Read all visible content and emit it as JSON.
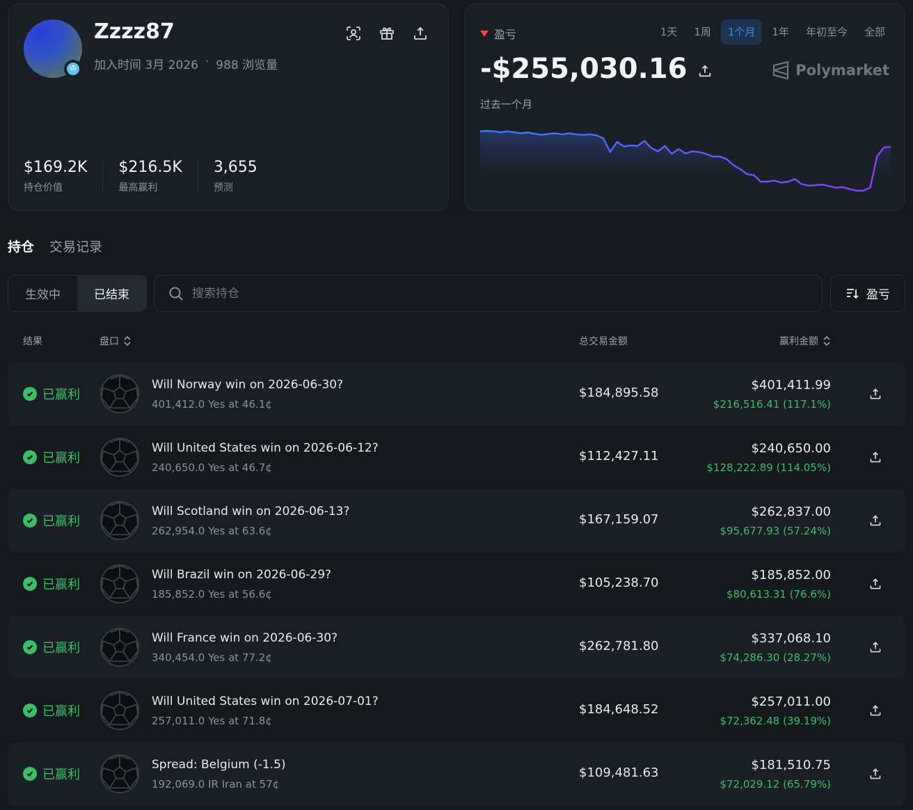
{
  "profile": {
    "username": "Zzzz87",
    "joined": "加入时间 3月 2026",
    "separator": "·",
    "views": "988 浏览量",
    "stats": [
      {
        "value": "$169.2K",
        "label": "持仓价值"
      },
      {
        "value": "$216.5K",
        "label": "最高赢利"
      },
      {
        "value": "3,655",
        "label": "预测"
      }
    ],
    "icons": [
      "scan-face-icon",
      "gift-icon",
      "share-icon"
    ]
  },
  "pnl": {
    "label": "盈亏",
    "value": "-$255,030.16",
    "period": "过去一个月",
    "brand": "Polymarket",
    "ranges": [
      "1天",
      "1周",
      "1个月",
      "1年",
      "年初至今",
      "全部"
    ],
    "active_range": "1个月",
    "colors": {
      "line_start": "#2f80ff",
      "line_end": "#8a3cff",
      "negative": "#e5484d"
    },
    "chart_data": {
      "type": "line",
      "title": "",
      "xlabel": "",
      "ylabel": "",
      "x": [
        0,
        1,
        2,
        3,
        4,
        5,
        6,
        7,
        8,
        9,
        10,
        11,
        12,
        13,
        14,
        15,
        16,
        17,
        18,
        19,
        20,
        21,
        22,
        23,
        24,
        25,
        26,
        27,
        28,
        29,
        30,
        31,
        32,
        33,
        34,
        35,
        36,
        37,
        38,
        39,
        40,
        41,
        42,
        43,
        44,
        45,
        46,
        47,
        48,
        49,
        50,
        51,
        52,
        53,
        54,
        55,
        56,
        57,
        58,
        59,
        60
      ],
      "values": [
        -150,
        -149,
        -150,
        -152,
        -150,
        -152,
        -154,
        -152,
        -155,
        -157,
        -155,
        -154,
        -156,
        -154,
        -156,
        -157,
        -156,
        -158,
        -164,
        -191,
        -171,
        -180,
        -178,
        -179,
        -169,
        -183,
        -190,
        -179,
        -195,
        -185,
        -194,
        -190,
        -191,
        -195,
        -200,
        -200,
        -205,
        -217,
        -225,
        -235,
        -237,
        -250,
        -250,
        -248,
        -252,
        -250,
        -245,
        -255,
        -258,
        -257,
        -256,
        -259,
        -262,
        -261,
        -265,
        -268,
        -268,
        -262,
        -200,
        -182,
        -181
      ],
      "series": [
        {
          "values": []
        }
      ]
    }
  },
  "tabs": {
    "items": [
      "持仓",
      "交易记录"
    ],
    "active": "持仓"
  },
  "filter": {
    "segments": [
      "生效中",
      "已结束"
    ],
    "active_segment": "已结束",
    "search_placeholder": "搜索持仓",
    "sort_label": "盈亏"
  },
  "table": {
    "headers": {
      "result": "结果",
      "market": "盘口",
      "total": "总交易金额",
      "win": "赢利金额"
    },
    "status_color": "#3dbd6a",
    "rows": [
      {
        "status": "已赢利",
        "title": "Will Norway win on 2026-06-30?",
        "sub": "401,412.0 Yes at 46.1¢",
        "total": "$184,895.58",
        "win": "$401,411.99",
        "profit": "$216,516.41 (117.1%)"
      },
      {
        "status": "已赢利",
        "title": "Will United States win on 2026-06-12?",
        "sub": "240,650.0 Yes at 46.7¢",
        "total": "$112,427.11",
        "win": "$240,650.00",
        "profit": "$128,222.89 (114.05%)"
      },
      {
        "status": "已赢利",
        "title": "Will Scotland win on 2026-06-13?",
        "sub": "262,954.0 Yes at 63.6¢",
        "total": "$167,159.07",
        "win": "$262,837.00",
        "profit": "$95,677.93 (57.24%)"
      },
      {
        "status": "已赢利",
        "title": "Will Brazil win on 2026-06-29?",
        "sub": "185,852.0 Yes at 56.6¢",
        "total": "$105,238.70",
        "win": "$185,852.00",
        "profit": "$80,613.31 (76.6%)"
      },
      {
        "status": "已赢利",
        "title": "Will France win on 2026-06-30?",
        "sub": "340,454.0 Yes at 77.2¢",
        "total": "$262,781.80",
        "win": "$337,068.10",
        "profit": "$74,286.30 (28.27%)"
      },
      {
        "status": "已赢利",
        "title": "Will United States win on 2026-07-01?",
        "sub": "257,011.0 Yes at 71.8¢",
        "total": "$184,648.52",
        "win": "$257,011.00",
        "profit": "$72,362.48 (39.19%)"
      },
      {
        "status": "已赢利",
        "title": "Spread: Belgium (-1.5)",
        "sub": "192,069.0 IR Iran at 57¢",
        "total": "$109,481.63",
        "win": "$181,510.75",
        "profit": "$72,029.12 (65.79%)"
      }
    ]
  }
}
